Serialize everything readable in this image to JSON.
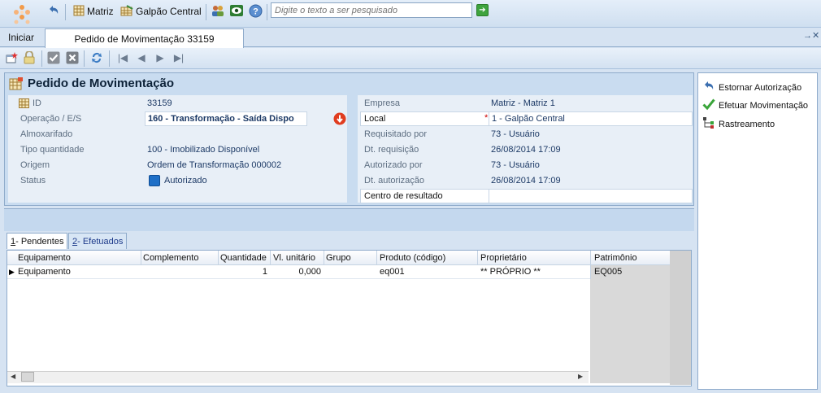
{
  "toolbar": {
    "matriz": "Matriz",
    "galpao": "Galpão Central",
    "search_placeholder": "Digite o texto a ser pesquisado"
  },
  "tabs": {
    "home": "Iniciar",
    "document": "Pedido de Movimentação 33159"
  },
  "form": {
    "title": "Pedido de Movimentação",
    "left": [
      {
        "label": "ID",
        "value": "33159"
      },
      {
        "label": "Operação / E/S",
        "value": "160 - Transformação - Saída Dispo"
      },
      {
        "label": "Almoxarifado",
        "value": ""
      },
      {
        "label": "Tipo quantidade",
        "value": "100 - Imobilizado Disponível"
      },
      {
        "label": "Origem",
        "value": "Ordem de Transformação 000002"
      },
      {
        "label": "Status",
        "value": "Autorizado"
      }
    ],
    "right": [
      {
        "label": "Empresa",
        "value": "Matriz - Matriz 1"
      },
      {
        "label": "Local",
        "value": "1 - Galpão Central"
      },
      {
        "label": "Requisitado por",
        "value": "73 - Usuário"
      },
      {
        "label": "Dt. requisição",
        "value": "26/08/2014 17:09"
      },
      {
        "label": "Autorizado por",
        "value": "73 - Usuário"
      },
      {
        "label": "Dt. autorização",
        "value": "26/08/2014 17:09"
      },
      {
        "label": "Centro de resultado",
        "value": ""
      }
    ]
  },
  "actions": {
    "estornar": "Estornar Autorização",
    "efetuar": "Efetuar Movimentação",
    "rastreamento": "Rastreamento"
  },
  "grid_tabs": {
    "pendentes_num": "1",
    "pendentes": " - Pendentes",
    "efetuados_num": "2",
    "efetuados": " - Efetuados"
  },
  "grid": {
    "columns": [
      "Equipamento",
      "Complemento",
      "Quantidade",
      "Vl. unitário",
      "Grupo",
      "Produto (código)",
      "Proprietário",
      "Patrimônio"
    ],
    "rows": [
      [
        "Equipamento",
        "",
        "1",
        "0,000",
        "",
        "eq001",
        "** PRÓPRIO **",
        "EQ005"
      ]
    ]
  },
  "colors": {
    "accent": "#1d3a66",
    "status_blue": "#1e6fc7",
    "required": "#cc0000"
  }
}
